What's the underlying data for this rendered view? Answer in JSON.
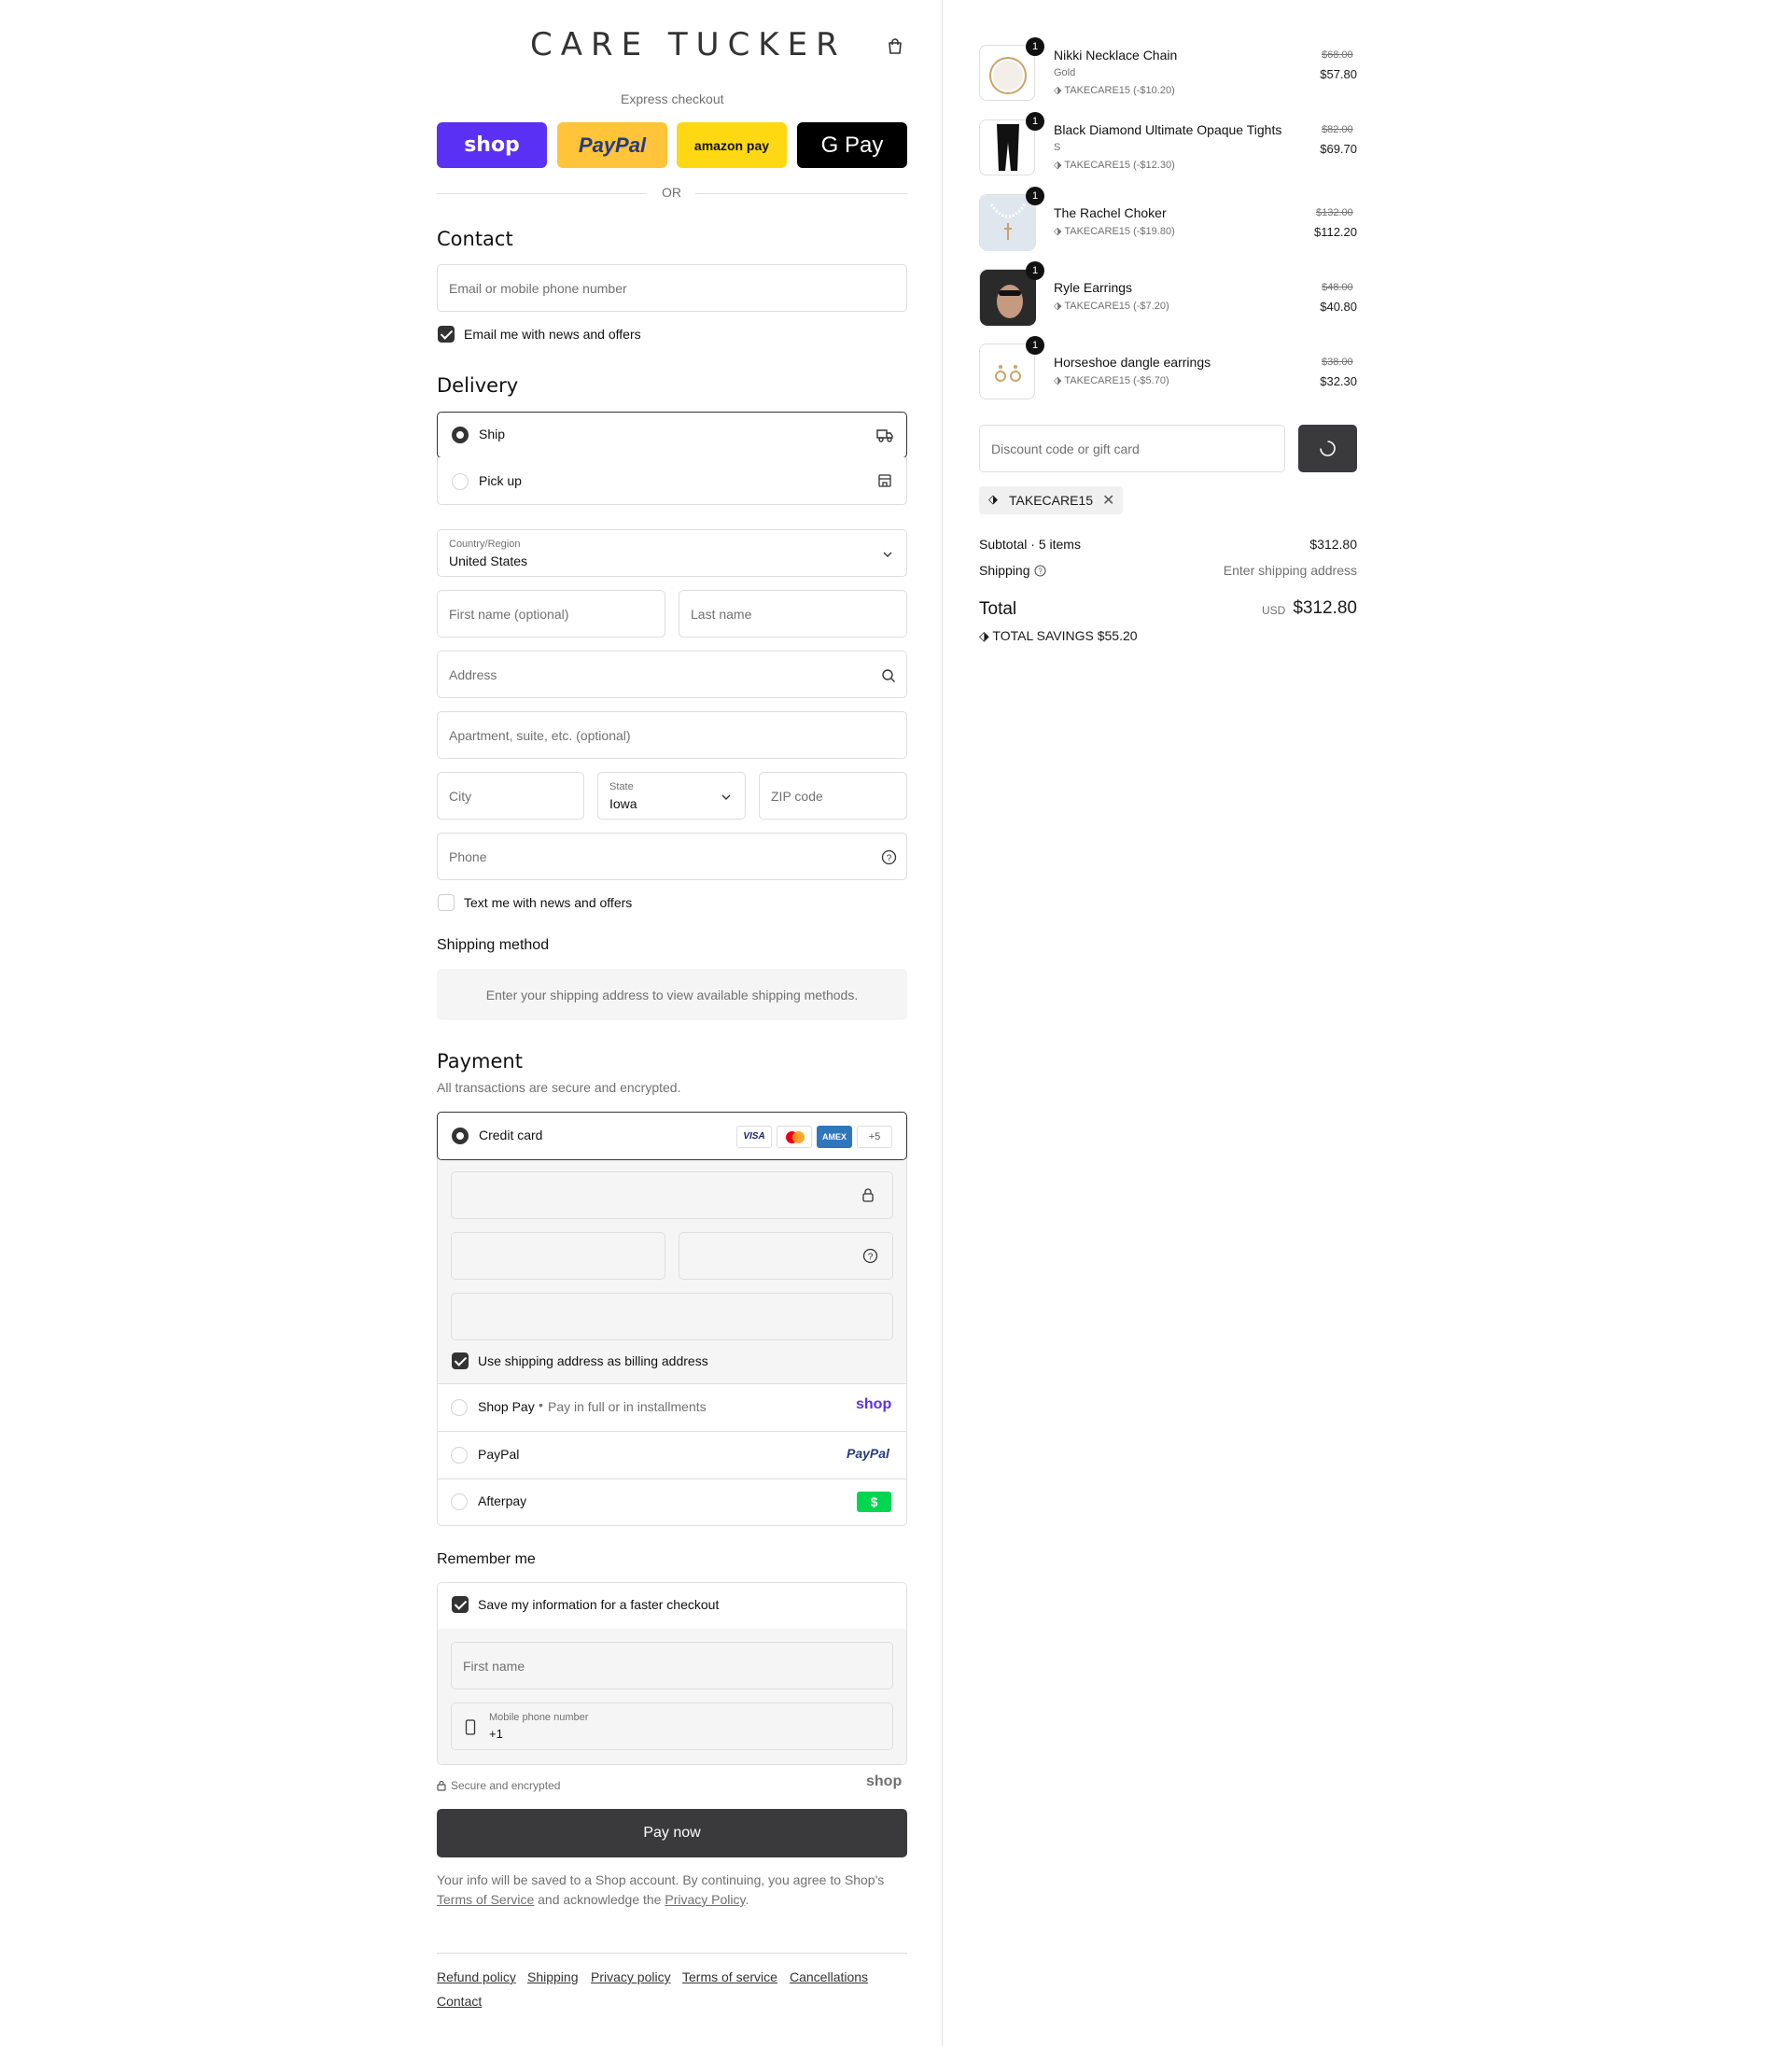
{
  "brand": {
    "name": "CARE TUCKER"
  },
  "express": {
    "label": "Express checkout",
    "buttons": [
      "shop",
      "PayPal",
      "amazon pay",
      "G Pay"
    ],
    "or": "OR"
  },
  "contact": {
    "title": "Contact",
    "email_placeholder": "Email or mobile phone number",
    "news_label": "Email me with news and offers",
    "news_checked": true
  },
  "delivery": {
    "title": "Delivery",
    "options": [
      {
        "label": "Ship",
        "selected": true
      },
      {
        "label": "Pick up",
        "selected": false
      }
    ],
    "country_label": "Country/Region",
    "country_value": "United States",
    "first_name_placeholder": "First name (optional)",
    "last_name_placeholder": "Last name",
    "address_placeholder": "Address",
    "apartment_placeholder": "Apartment, suite, etc. (optional)",
    "city_placeholder": "City",
    "state_label": "State",
    "state_value": "Iowa",
    "zip_placeholder": "ZIP code",
    "phone_placeholder": "Phone",
    "text_label": "Text me with news and offers"
  },
  "shipping_method": {
    "title": "Shipping method",
    "message": "Enter your shipping address to view available shipping methods."
  },
  "payment": {
    "title": "Payment",
    "subtitle": "All transactions are secure and encrypted.",
    "credit_card_label": "Credit card",
    "card_logos": [
      "VISA",
      "mastercard",
      "AMEX",
      "+5"
    ],
    "billing_label": "Use shipping address as billing address",
    "shop_pay_label": "Shop Pay",
    "shop_pay_sub": "Pay in full or in installments",
    "shop_pay_logo": "shop",
    "paypal_label": "PayPal",
    "paypal_logo": "PayPal",
    "afterpay_label": "Afterpay",
    "afterpay_logo": "$"
  },
  "remember": {
    "title": "Remember me",
    "save_label": "Save my information for a faster checkout",
    "first_name_placeholder": "First name",
    "mobile_label": "Mobile phone number",
    "mobile_value": "+1"
  },
  "secure": {
    "label": "Secure and encrypted",
    "shop_logo": "shop"
  },
  "pay_now": "Pay now",
  "legal": {
    "line1": "Your info will be saved to a Shop account. By continuing, you agree to Shop's",
    "terms": "Terms of Service",
    "and": "and acknowledge the",
    "privacy": "Privacy Policy",
    "end": "."
  },
  "footer_links": [
    "Refund policy",
    "Shipping",
    "Privacy policy",
    "Terms of service",
    "Cancellations",
    "Contact"
  ],
  "cart": {
    "items": [
      {
        "name": "Nikki Necklace Chain",
        "variant": "Gold",
        "discount": "TAKECARE15 (-$10.20)",
        "original": "$68.00",
        "price": "$57.80",
        "qty": "1"
      },
      {
        "name": "Black Diamond Ultimate Opaque Tights",
        "variant": "S",
        "discount": "TAKECARE15 (-$12.30)",
        "original": "$82.00",
        "price": "$69.70",
        "qty": "1"
      },
      {
        "name": "The Rachel Choker",
        "variant": "",
        "discount": "TAKECARE15 (-$19.80)",
        "original": "$132.00",
        "price": "$112.20",
        "qty": "1"
      },
      {
        "name": "Ryle Earrings",
        "variant": "",
        "discount": "TAKECARE15 (-$7.20)",
        "original": "$48.00",
        "price": "$40.80",
        "qty": "1"
      },
      {
        "name": "Horseshoe dangle earrings",
        "variant": "",
        "discount": "TAKECARE15 (-$5.70)",
        "original": "$38.00",
        "price": "$32.30",
        "qty": "1"
      }
    ],
    "discount_placeholder": "Discount code or gift card",
    "applied_code": "TAKECARE15",
    "subtotal_label": "Subtotal · 5 items",
    "subtotal_value": "$312.80",
    "shipping_label": "Shipping",
    "shipping_value": "Enter shipping address",
    "total_label": "Total",
    "currency": "USD",
    "total_value": "$312.80",
    "savings_label": "TOTAL SAVINGS",
    "savings_value": "$55.20"
  }
}
